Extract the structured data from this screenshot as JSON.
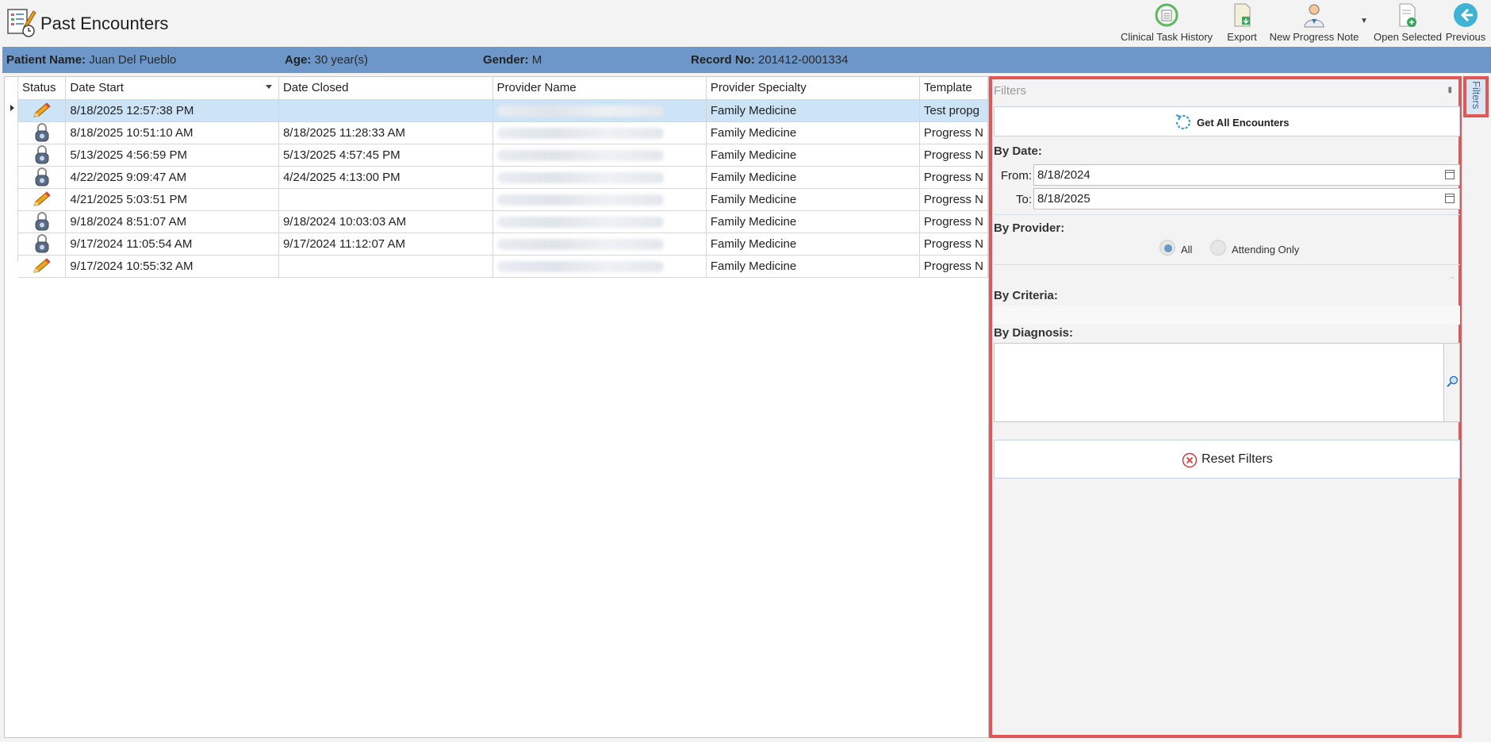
{
  "app": {
    "title": "Past Encounters"
  },
  "toolbar": {
    "buttons": [
      {
        "label": "Clinical Task History",
        "icon": "clock-history-icon"
      },
      {
        "label": "Export",
        "icon": "export-document-icon"
      },
      {
        "label": "New Progress Note",
        "icon": "doctor-icon"
      },
      {
        "label": "Open Selected",
        "icon": "open-document-icon"
      },
      {
        "label": "Previous",
        "icon": "back-arrow-icon"
      }
    ]
  },
  "patient": {
    "name_label": "Patient Name:",
    "name": "Juan Del Pueblo",
    "age_label": "Age:",
    "age": "30 year(s)",
    "gender_label": "Gender:",
    "gender": "M",
    "record_label": "Record No:",
    "record": "201412-0001334"
  },
  "grid": {
    "columns": [
      "Status",
      "Date Start",
      "Date Closed",
      "Provider Name",
      "Provider Specialty",
      "Template"
    ],
    "rows": [
      {
        "status": "pencil",
        "date_start": "8/18/2025 12:57:38 PM",
        "date_closed": "",
        "specialty": "Family Medicine",
        "template": "Test propg"
      },
      {
        "status": "lock",
        "date_start": "8/18/2025 10:51:10 AM",
        "date_closed": "8/18/2025 11:28:33 AM",
        "specialty": "Family Medicine",
        "template": "Progress N"
      },
      {
        "status": "lock",
        "date_start": "5/13/2025 4:56:59 PM",
        "date_closed": "5/13/2025 4:57:45 PM",
        "specialty": "Family Medicine",
        "template": "Progress N"
      },
      {
        "status": "lock",
        "date_start": "4/22/2025 9:09:47 AM",
        "date_closed": "4/24/2025 4:13:00 PM",
        "specialty": "Family Medicine",
        "template": "Progress N"
      },
      {
        "status": "pencil",
        "date_start": "4/21/2025 5:03:51 PM",
        "date_closed": "",
        "specialty": "Family Medicine",
        "template": "Progress N"
      },
      {
        "status": "lock",
        "date_start": "9/18/2024 8:51:07 AM",
        "date_closed": "9/18/2024 10:03:03 AM",
        "specialty": "Family Medicine",
        "template": "Progress N"
      },
      {
        "status": "lock",
        "date_start": "9/17/2024 11:05:54 AM",
        "date_closed": "9/17/2024 11:12:07 AM",
        "specialty": "Family Medicine",
        "template": "Progress N"
      },
      {
        "status": "pencil",
        "date_start": "9/17/2024 10:55:32 AM",
        "date_closed": "",
        "specialty": "Family Medicine",
        "template": "Progress N"
      }
    ]
  },
  "filters": {
    "header": "Filters",
    "get_all": "Get All Encounters",
    "by_date": "By Date:",
    "from_label": "From:",
    "from_value": "8/18/2024",
    "to_label": "To:",
    "to_value": "8/18/2025",
    "by_provider": "By Provider:",
    "provider_options": [
      "All",
      "Attending Only"
    ],
    "provider_selected": "All",
    "by_criteria": "By Criteria:",
    "by_diagnosis": "By Diagnosis:",
    "reset": "Reset Filters",
    "tab_label": "Filters"
  },
  "colors": {
    "accent": "#6c97c8",
    "highlight": "#e15656",
    "selected_row": "#cde3f6"
  }
}
